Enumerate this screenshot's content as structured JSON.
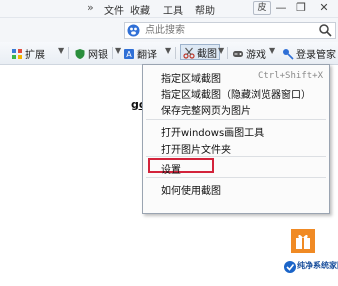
{
  "titlebar": {
    "chevron": "»",
    "menu": [
      "文件",
      "收藏",
      "工具",
      "帮助"
    ],
    "skin_label": "皮",
    "min": "—",
    "restore": "❐",
    "close": "✕"
  },
  "search": {
    "placeholder": "点此搜索"
  },
  "toolbar": {
    "expand": "扩展",
    "netbank": "网银",
    "translate": "翻译",
    "screenshot": "截图",
    "game": "游戏",
    "login": "登录管家"
  },
  "page": {
    "text": "go"
  },
  "dropdown": {
    "items": [
      {
        "label": "指定区域截图",
        "shortcut": "Ctrl+Shift+X"
      },
      {
        "label": "指定区域截图（隐藏浏览器窗口）",
        "shortcut": ""
      },
      {
        "label": "保存完整网页为图片",
        "shortcut": ""
      },
      {
        "label": "打开windows画图工具",
        "shortcut": ""
      },
      {
        "label": "打开图片文件夹",
        "shortcut": ""
      },
      {
        "label": "设置",
        "shortcut": ""
      },
      {
        "label": "如何使用截图",
        "shortcut": ""
      }
    ]
  },
  "watermark": {
    "text": "纯净系统家园"
  },
  "colors": {
    "highlight": "#d3233b",
    "promo": "#f08a24"
  }
}
